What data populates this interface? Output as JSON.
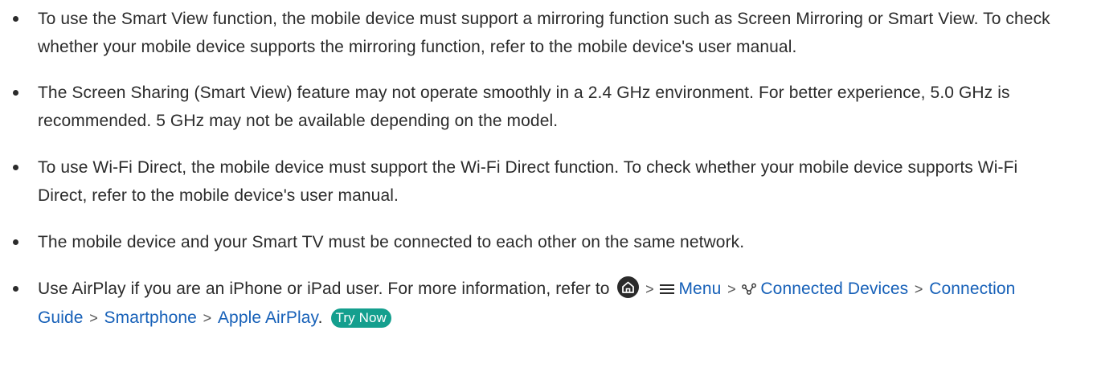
{
  "notes": [
    {
      "text": "To use the Smart View function, the mobile device must support a mirroring function such as Screen Mirroring or Smart View. To check whether your mobile device supports the mirroring function, refer to the mobile device's user manual."
    },
    {
      "text": "The Screen Sharing (Smart View) feature may not operate smoothly in a 2.4 GHz environment. For better experience, 5.0 GHz is recommended. 5 GHz may not be available depending on the model."
    },
    {
      "text": "To use Wi-Fi Direct, the mobile device must support the Wi-Fi Direct function. To check whether your mobile device supports Wi-Fi Direct, refer to the mobile device's user manual."
    },
    {
      "text": "The mobile device and your Smart TV must be connected to each other on the same network."
    },
    {
      "intro": "Use AirPlay if you are an iPhone or iPad user. For more information, refer to",
      "separator": ">",
      "path": {
        "menu": "Menu",
        "connected_devices": "Connected Devices",
        "connection_guide": "Connection Guide",
        "smartphone": "Smartphone",
        "apple_airplay": "Apple AirPlay"
      },
      "end_punctuation": ".",
      "try_now": "Try Now"
    }
  ],
  "icons": {
    "home": "home-icon",
    "menu": "menu-icon",
    "connected": "connected-devices-icon"
  },
  "colors": {
    "text": "#2b2b2b",
    "link": "#1660b8",
    "try_now_bg": "#149f8e"
  }
}
